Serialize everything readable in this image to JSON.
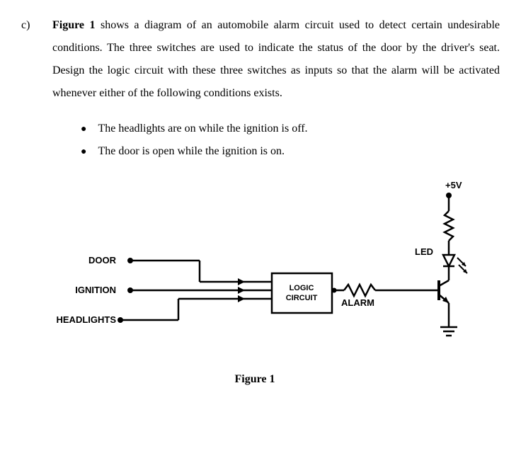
{
  "question": {
    "label": "c)",
    "intro_prefix": "Figure 1",
    "intro_rest": " shows a diagram of an automobile alarm circuit used to detect certain undesirable conditions. The three switches are used to indicate the status of the door by the driver's seat. Design the logic circuit with these three switches as inputs so that the alarm will be activated whenever either of the following conditions exists."
  },
  "conditions": [
    "The headlights are on while the ignition is off.",
    "The door is open while the ignition is on."
  ],
  "figure": {
    "caption": "Figure 1",
    "labels": {
      "door": "DOOR",
      "ignition": "IGNITION",
      "headlights": "HEADLIGHTS",
      "logic": "LOGIC",
      "circuit": "CIRCUIT",
      "alarm": "ALARM",
      "vcc": "+5V",
      "led": "LED"
    }
  }
}
